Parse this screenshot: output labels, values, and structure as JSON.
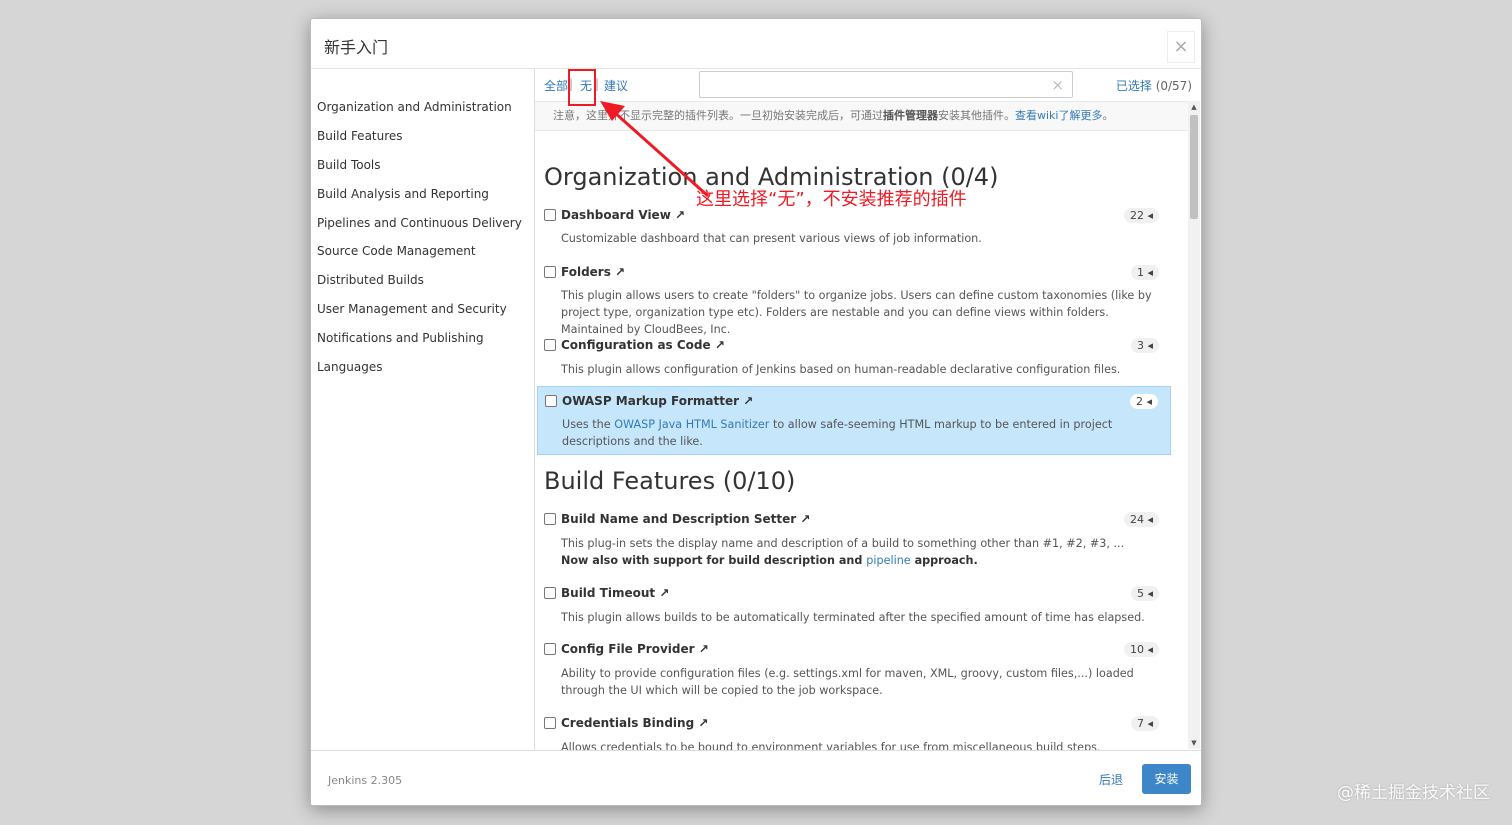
{
  "dialog": {
    "title": "新手入门",
    "close": "×"
  },
  "sidebar": {
    "items": [
      "Organization and Administration",
      "Build Features",
      "Build Tools",
      "Build Analysis and Reporting",
      "Pipelines and Continuous Delivery",
      "Source Code Management",
      "Distributed Builds",
      "User Management and Security",
      "Notifications and Publishing",
      "Languages"
    ]
  },
  "filter": {
    "all": "全部",
    "none": "无",
    "suggested": "建议",
    "sep": "|",
    "search_value": "",
    "clear": "×",
    "selected_label": "已选择",
    "selected_count": "(0/57)"
  },
  "notice": {
    "prefix": "注意，这里并不显示完整的插件列表。一旦初始安装完成后，可通过",
    "bold": "插件管理器",
    "middle": "安装其他插件。",
    "link": "查看wiki了解更多",
    "suffix": "。"
  },
  "sections": [
    {
      "title": "Organization and Administration (0/4)"
    },
    {
      "title": "Build Features (0/10)"
    }
  ],
  "plugins": [
    {
      "name": "Dashboard View ↗",
      "count": "22 ◂",
      "desc": "Customizable dashboard that can present various views of job information."
    },
    {
      "name": "Folders ↗",
      "count": "1 ◂",
      "desc": "This plugin allows users to create \"folders\" to organize jobs. Users can define custom taxonomies (like by project type, organization type etc). Folders are nestable and you can define views within folders. Maintained by CloudBees, Inc."
    },
    {
      "name": "Configuration as Code ↗",
      "count": "3 ◂",
      "desc": "This plugin allows configuration of Jenkins based on human-readable declarative configuration files."
    },
    {
      "name": "OWASP Markup Formatter ↗",
      "count": "2 ◂",
      "desc_pre": "Uses the ",
      "desc_link": "OWASP Java HTML Sanitizer",
      "desc_post": " to allow safe-seeming HTML markup to be entered in project descriptions and the like."
    },
    {
      "name": "Build Name and Description Setter ↗",
      "count": "24 ◂",
      "desc": "This plug-in sets the display name and description of a build to something other than #1, #2, #3, ...",
      "desc2_bold": "Now also with support for build description and ",
      "desc2_link": "pipeline",
      "desc2_bold_end": " approach."
    },
    {
      "name": "Build Timeout ↗",
      "count": "5 ◂",
      "desc": "This plugin allows builds to be automatically terminated after the specified amount of time has elapsed."
    },
    {
      "name": "Config File Provider ↗",
      "count": "10 ◂",
      "desc": "Ability to provide configuration files (e.g. settings.xml for maven, XML, groovy, custom files,...) loaded through the UI which will be copied to the job workspace."
    },
    {
      "name": "Credentials Binding ↗",
      "count": "7 ◂",
      "desc": "Allows credentials to be bound to environment variables for use from miscellaneous build steps."
    }
  ],
  "footer": {
    "version": "Jenkins 2.305",
    "back": "后退",
    "install": "安装"
  },
  "annotation": {
    "text": "这里选择“无”，不安装推荐的插件",
    "color": "#ee1b24"
  },
  "watermark": "@稀土掘金技术社区",
  "colors": {
    "link": "#337ab7",
    "highlight": "#c6e6fb",
    "primary_button": "#3d87c8"
  }
}
